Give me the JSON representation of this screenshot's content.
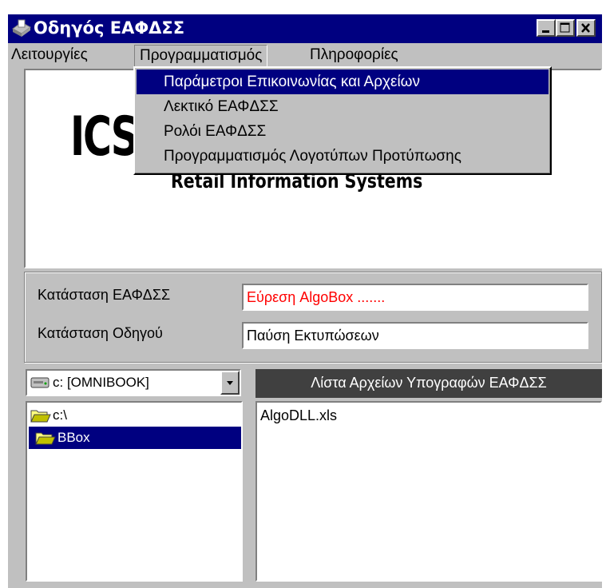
{
  "window": {
    "title": "Οδηγός ΕΑΦΔΣΣ",
    "controls": [
      "minimize-icon",
      "maximize-icon",
      "close-icon"
    ],
    "colors": {
      "titlebar": "#000080",
      "face": "#c0c0c0",
      "selection": "#000080",
      "status_error": "#ff0000"
    }
  },
  "menubar": {
    "items": [
      {
        "label": "Λειτουργίες"
      },
      {
        "label": "Προγραμματισμός"
      },
      {
        "label": "Πληροφορίες"
      }
    ]
  },
  "dropdown": {
    "items": [
      {
        "label": "Παράμετροι Επικοινωνίας και Αρχείων",
        "selected": true
      },
      {
        "label": "Λεκτικό ΕΑΦΔΣΣ"
      },
      {
        "label": "Ρολόι   ΕΑΦΔΣΣ"
      },
      {
        "label": "Προγραμματισμός Λογοτύπων Προτύπωσης"
      }
    ]
  },
  "logo": {
    "text": "ICS",
    "subtitle": "Retail Information Systems"
  },
  "status": {
    "device_label": "Κατάσταση ΕΑΦΔΣΣ",
    "device_value": "Εύρεση AlgoBox .......",
    "driver_label": "Κατάσταση Οδηγού",
    "driver_value": "Παύση Εκτυπώσεων"
  },
  "drive": {
    "selected": "c: [OMNIBOOK]",
    "icon": "drive-icon"
  },
  "directories": {
    "items": [
      {
        "label": "c:\\",
        "icon": "folder-open-icon"
      },
      {
        "label": "BBox",
        "icon": "folder-open-icon",
        "selected": true
      }
    ]
  },
  "files": {
    "header": "Λίστα Αρχείων Υπογραφών ΕΑΦΔΣΣ",
    "items": [
      "AlgoDLL.xls"
    ]
  }
}
